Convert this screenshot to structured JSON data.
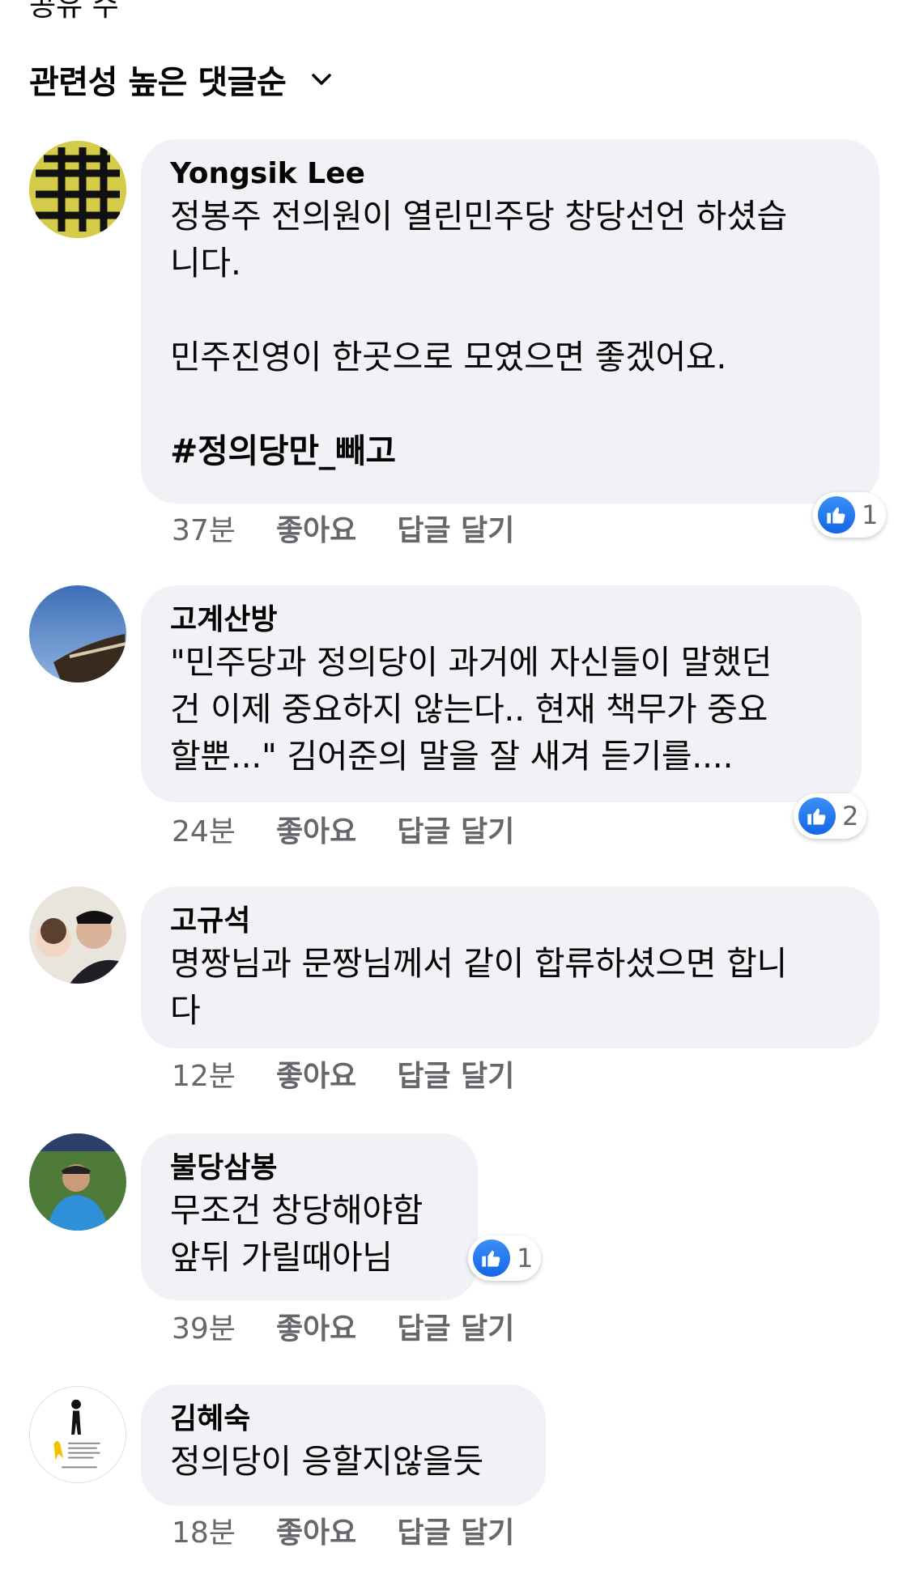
{
  "sort": {
    "label": "관련성 높은 댓글순"
  },
  "top_cut": "공유 수",
  "colors": {
    "bubble": "#f0f2f5",
    "meta": "#65676b",
    "like": "#1877f2"
  },
  "comments": [
    {
      "author": "Yongsik Lee",
      "text": "정봉주 전의원이 열린민주당 창당선언 하셨습\n니다.\n\n민주진영이 한곳으로 모였으면 좋겠어요.",
      "hashtag": "#정의당만_빼고",
      "time": "37분",
      "like": "좋아요",
      "reply": "답글 달기",
      "reactions": "1"
    },
    {
      "author": "고계산방",
      "text": "\"민주당과 정의당이 과거에 자신들이 말했던\n건 이제 중요하지 않는다.. 현재 책무가 중요\n할뿐...\" 김어준의 말을 잘 새겨 듣기를....",
      "time": "24분",
      "like": "좋아요",
      "reply": "답글 달기",
      "reactions": "2"
    },
    {
      "author": "고규석",
      "text": "명짱님과 문짱님께서 같이 합류하셨으면 합니\n다",
      "time": "12분",
      "like": "좋아요",
      "reply": "답글 달기"
    },
    {
      "author": "불당삼봉",
      "text": "무조건 창당해야함\n앞뒤 가릴때아님",
      "time": "39분",
      "like": "좋아요",
      "reply": "답글 달기",
      "reactions": "1"
    },
    {
      "author": "김혜숙",
      "text": "정의당이 응할지않을듯",
      "time": "18분",
      "like": "좋아요",
      "reply": "답글 달기"
    }
  ]
}
